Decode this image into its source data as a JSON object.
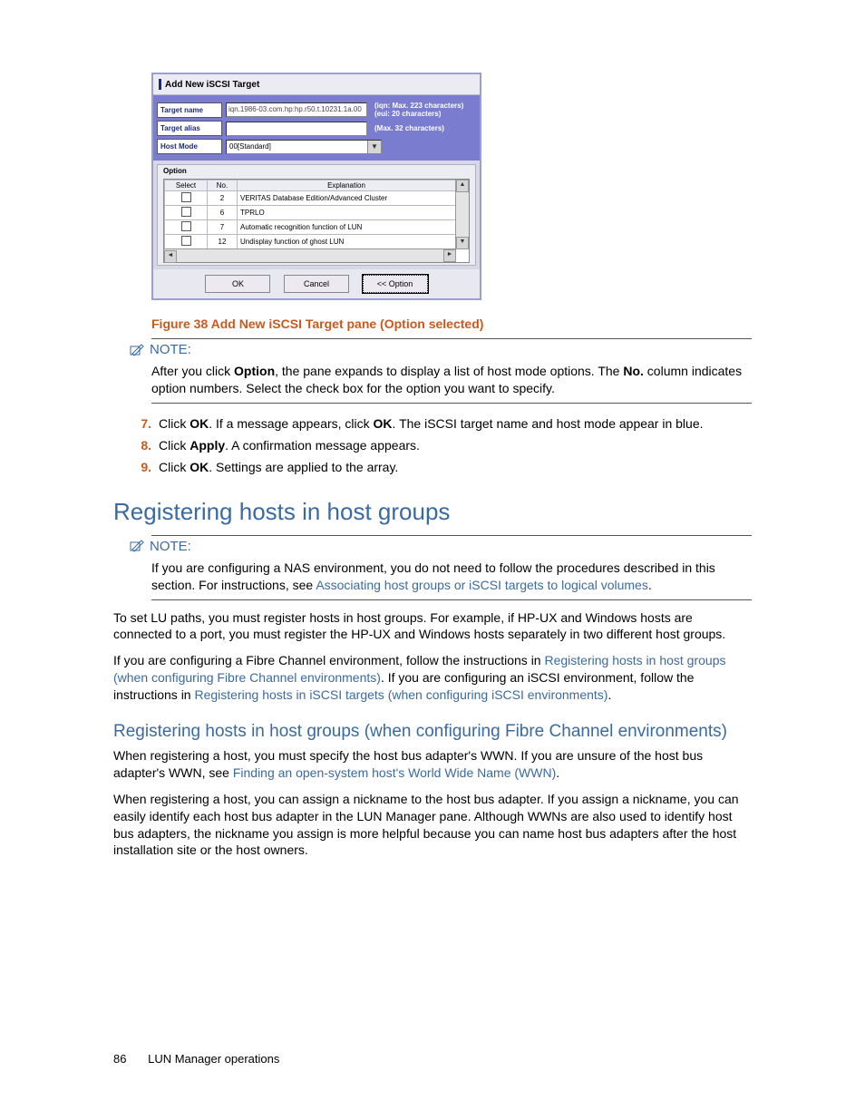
{
  "screenshot": {
    "window_title": "Add New iSCSI Target",
    "fields": {
      "target_name": {
        "label": "Target name",
        "value": "iqn.1986-03.com.hp:hp.r50.t.10231.1a.00",
        "hint": "(iqn: Max. 223 characters)\n(eui: 20 characters)"
      },
      "target_alias": {
        "label": "Target alias",
        "value": "",
        "hint": "(Max. 32 characters)"
      },
      "host_mode": {
        "label": "Host Mode",
        "value": "00[Standard]"
      }
    },
    "option": {
      "title": "Option",
      "headers": [
        "Select",
        "No.",
        "Explanation"
      ],
      "rows": [
        {
          "no": "2",
          "expl": "VERITAS Database Edition/Advanced Cluster"
        },
        {
          "no": "6",
          "expl": "TPRLO"
        },
        {
          "no": "7",
          "expl": "Automatic recognition function of LUN"
        },
        {
          "no": "12",
          "expl": "Undisplay function of ghost LUN"
        }
      ]
    },
    "buttons": {
      "ok": "OK",
      "cancel": "Cancel",
      "option": "<< Option"
    }
  },
  "caption": {
    "figure": "Figure 38",
    "text": "Add New iSCSI Target pane (Option selected)"
  },
  "note1": {
    "label": "NOTE:",
    "body_pre": "After you click ",
    "body_bold1": "Option",
    "body_mid": ", the pane expands to display a list of host mode options. The ",
    "body_bold2": "No.",
    "body_post": " column indicates option numbers. Select the check box for the option you want to specify."
  },
  "steps": {
    "s7": {
      "num": "7.",
      "pre": "Click ",
      "b1": "OK",
      "mid1": ". If a message appears, click ",
      "b2": "OK",
      "post": ". The iSCSI target name and host mode appear in blue."
    },
    "s8": {
      "num": "8.",
      "pre": "Click ",
      "b1": "Apply",
      "post": ". A confirmation message appears."
    },
    "s9": {
      "num": "9.",
      "pre": "Click ",
      "b1": "OK",
      "post": ". Settings are applied to the array."
    }
  },
  "h1": "Registering hosts in host groups",
  "note2": {
    "label": "NOTE:",
    "pre": "If you are configuring a NAS environment, you do not need to follow the procedures described in this section. For instructions, see ",
    "link": "Associating host groups or iSCSI targets to logical volumes",
    "post": "."
  },
  "para1": "To set LU paths, you must register hosts in host groups. For example, if HP-UX and Windows hosts are connected to a port, you must register the HP-UX and Windows hosts separately in two different host groups.",
  "para2": {
    "pre": "If you are configuring a Fibre Channel environment, follow the instructions in ",
    "link1": "Registering hosts in host groups (when configuring Fibre Channel environments)",
    "mid": ". If you are configuring an iSCSI environment, follow the instructions in ",
    "link2": "Registering hosts in iSCSI targets (when configuring iSCSI environments)",
    "post": "."
  },
  "h2": "Registering hosts in host groups (when configuring Fibre Channel environments)",
  "para3": {
    "pre": "When registering a host, you must specify the host bus adapter's WWN. If you are unsure of the host bus adapter's WWN, see ",
    "link": "Finding an open-system host's World Wide Name (WWN)",
    "post": "."
  },
  "para4": "When registering a host, you can assign a nickname to the host bus adapter. If you assign a nickname, you can easily identify each host bus adapter in the LUN Manager pane. Although WWNs are also used to identify host bus adapters, the nickname you assign is more helpful because you can name host bus adapters after the host installation site or the host owners.",
  "footer": {
    "page": "86",
    "title": "LUN Manager operations"
  }
}
